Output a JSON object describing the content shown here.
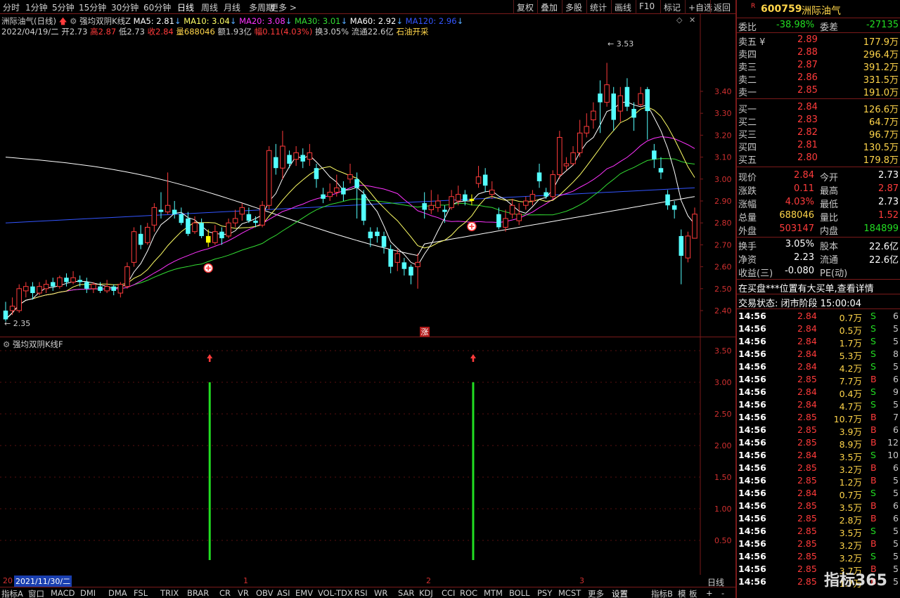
{
  "toolbar": {
    "periods": [
      "分时",
      "1分钟",
      "5分钟",
      "15分钟",
      "30分钟",
      "60分钟",
      "日线",
      "周线",
      "月线",
      "多周期",
      "更多 >"
    ],
    "active_period": "日线",
    "right_buttons": [
      "复权",
      "叠加",
      "多股",
      "统计",
      "画线",
      "F10",
      "标记",
      "+自选",
      "返回"
    ]
  },
  "kline_header": {
    "name": "洲际油气(日线)",
    "indicator": "强均双阴K线Z",
    "ma5": "MA5: 2.81",
    "ma10": "MA10: 3.04",
    "ma20": "MA20: 3.08",
    "ma30": "MA30: 3.01",
    "ma60": "MA60: 2.92",
    "ma120": "MA120: 2.96",
    "date": "2022/04/19/二",
    "open": "开2.73",
    "high": "高2.87",
    "low": "低2.73",
    "close": "收2.84",
    "volume": "量688046",
    "amount": "额1.93亿",
    "change": "幅0.11(4.03%)",
    "turnover": "换3.05%",
    "float": "流通22.6亿",
    "sector": "石油开采"
  },
  "colors": {
    "up": "#ff3b3b",
    "down": "#54ffff",
    "ma5": "#ffffff",
    "ma10": "#ffff66",
    "ma20": "#ff33ff",
    "ma30": "#33dd33",
    "ma60": "#3355ff",
    "ma120": "#ffffff",
    "signal": "#22dd22",
    "highlight": "#ffff00"
  },
  "price_axis": [
    "3.40",
    "3.30",
    "3.20",
    "3.10",
    "3.00",
    "2.90",
    "2.80",
    "2.70",
    "2.60",
    "2.50",
    "2.40"
  ],
  "markers": {
    "high_label": "3.53",
    "low_label": "2.35",
    "zhang": "涨"
  },
  "sub_header": "强均双阴K线F",
  "sub_axis": [
    "3.50",
    "3.00",
    "2.50",
    "2.00",
    "1.50",
    "1.00",
    "0.50"
  ],
  "x_labels": {
    "start_year": "20",
    "cursor_date": "2021/11/30/二",
    "m1": "1",
    "m2": "2",
    "m3": "3",
    "period_tag": "日线"
  },
  "bottom_tabs": [
    "指标A",
    "窗口",
    "MACD",
    "DMI",
    "DMA",
    "FSL",
    "TRIX",
    "BRAR",
    "CR",
    "VR",
    "OBV",
    "ASI",
    "EMV",
    "VOL-TDX",
    "RSI",
    "WR",
    "SAR",
    "KDJ",
    "CCI",
    "ROC",
    "MTM",
    "BOLL",
    "PSY",
    "MCST",
    "更多",
    "设置"
  ],
  "bottom_right_tabs": [
    "指标B",
    "模",
    "板",
    "+",
    "-"
  ],
  "chart_data": {
    "type": "candlestick",
    "title": "",
    "ylim": [
      2.33,
      3.58
    ],
    "candles": [
      [
        2.4,
        2.36,
        2.44,
        2.35
      ],
      [
        2.4,
        2.42,
        2.46,
        2.38
      ],
      [
        2.4,
        2.5,
        2.52,
        2.39
      ],
      [
        2.49,
        2.51,
        2.53,
        2.46
      ],
      [
        2.51,
        2.48,
        2.53,
        2.45
      ],
      [
        2.48,
        2.51,
        2.53,
        2.47
      ],
      [
        2.5,
        2.52,
        2.54,
        2.48
      ],
      [
        2.53,
        2.51,
        2.55,
        2.49
      ],
      [
        2.51,
        2.55,
        2.56,
        2.5
      ],
      [
        2.55,
        2.53,
        2.57,
        2.51
      ],
      [
        2.53,
        2.55,
        2.58,
        2.52
      ],
      [
        2.54,
        2.53,
        2.56,
        2.51
      ],
      [
        2.53,
        2.5,
        2.55,
        2.48
      ],
      [
        2.5,
        2.52,
        2.53,
        2.48
      ],
      [
        2.51,
        2.49,
        2.53,
        2.48
      ],
      [
        2.49,
        2.51,
        2.54,
        2.48
      ],
      [
        2.51,
        2.49,
        2.52,
        2.47
      ],
      [
        2.48,
        2.52,
        2.53,
        2.46
      ],
      [
        2.51,
        2.6,
        2.62,
        2.5
      ],
      [
        2.62,
        2.76,
        2.78,
        2.6
      ],
      [
        2.75,
        2.7,
        2.79,
        2.68
      ],
      [
        2.71,
        2.78,
        2.8,
        2.7
      ],
      [
        2.79,
        2.87,
        2.89,
        2.76
      ],
      [
        2.86,
        2.85,
        2.94,
        2.82
      ],
      [
        2.85,
        2.88,
        3.03,
        2.84
      ],
      [
        2.86,
        2.84,
        2.9,
        2.82
      ],
      [
        2.84,
        2.8,
        2.87,
        2.79
      ],
      [
        2.82,
        2.75,
        2.85,
        2.74
      ],
      [
        2.76,
        2.8,
        2.83,
        2.75
      ],
      [
        2.8,
        2.74,
        2.82,
        2.73
      ],
      [
        2.74,
        2.71,
        2.77,
        2.69
      ],
      [
        2.71,
        2.76,
        2.79,
        2.7
      ],
      [
        2.76,
        2.73,
        2.78,
        2.7
      ],
      [
        2.74,
        2.8,
        2.82,
        2.73
      ],
      [
        2.8,
        2.82,
        2.86,
        2.78
      ],
      [
        2.84,
        2.87,
        2.89,
        2.81
      ],
      [
        2.84,
        2.81,
        2.87,
        2.8
      ],
      [
        2.81,
        2.8,
        2.83,
        2.78
      ],
      [
        2.79,
        2.88,
        2.9,
        2.78
      ],
      [
        2.88,
        3.13,
        3.15,
        2.86
      ],
      [
        3.1,
        3.05,
        3.16,
        3.02
      ],
      [
        3.05,
        3.15,
        3.22,
        3.0
      ],
      [
        3.11,
        3.07,
        3.13,
        3.05
      ],
      [
        3.09,
        3.12,
        3.15,
        3.06
      ],
      [
        3.11,
        3.08,
        3.14,
        3.05
      ],
      [
        3.09,
        3.12,
        3.16,
        3.06
      ],
      [
        3.05,
        3.0,
        3.07,
        2.96
      ],
      [
        2.93,
        2.91,
        2.96,
        2.89
      ],
      [
        2.92,
        2.94,
        2.98,
        2.9
      ],
      [
        2.94,
        2.96,
        3.02,
        2.92
      ],
      [
        2.96,
        2.93,
        2.99,
        2.9
      ],
      [
        3.0,
        3.02,
        3.07,
        2.98
      ],
      [
        3.0,
        2.96,
        3.03,
        2.82
      ],
      [
        2.93,
        2.81,
        2.95,
        2.79
      ],
      [
        2.76,
        2.73,
        2.78,
        2.69
      ],
      [
        2.76,
        2.74,
        2.78,
        2.71
      ],
      [
        2.74,
        2.69,
        2.76,
        2.66
      ],
      [
        2.68,
        2.6,
        2.7,
        2.57
      ],
      [
        2.62,
        2.66,
        2.68,
        2.58
      ],
      [
        2.62,
        2.59,
        2.64,
        2.56
      ],
      [
        2.6,
        2.56,
        2.61,
        2.52
      ],
      [
        2.6,
        2.62,
        2.66,
        2.5
      ],
      [
        2.89,
        2.86,
        2.94,
        2.82
      ],
      [
        2.86,
        2.88,
        2.95,
        2.84
      ],
      [
        2.87,
        2.9,
        2.93,
        2.85
      ],
      [
        2.86,
        2.85,
        2.88,
        2.8
      ],
      [
        2.87,
        2.92,
        2.95,
        2.86
      ],
      [
        2.9,
        2.93,
        2.97,
        2.88
      ],
      [
        2.93,
        2.9,
        2.95,
        2.88
      ],
      [
        2.91,
        2.9,
        2.93,
        2.88
      ],
      [
        2.98,
        3.01,
        3.06,
        2.96
      ],
      [
        3.02,
        2.97,
        3.05,
        2.94
      ],
      [
        2.93,
        2.95,
        2.99,
        2.91
      ],
      [
        2.84,
        2.78,
        2.87,
        2.77
      ],
      [
        2.78,
        2.82,
        2.86,
        2.76
      ],
      [
        2.84,
        2.88,
        2.91,
        2.82
      ],
      [
        2.81,
        2.84,
        2.89,
        2.79
      ],
      [
        2.88,
        2.9,
        2.92,
        2.86
      ],
      [
        2.9,
        2.93,
        2.95,
        2.88
      ],
      [
        3.03,
        2.99,
        3.07,
        2.96
      ],
      [
        2.94,
        2.92,
        2.96,
        2.91
      ],
      [
        2.92,
        3.02,
        3.04,
        2.91
      ],
      [
        3.02,
        3.19,
        3.22,
        3.0
      ],
      [
        3.06,
        3.07,
        3.1,
        3.04
      ],
      [
        3.07,
        3.12,
        3.15,
        3.06
      ],
      [
        3.12,
        3.21,
        3.27,
        3.1
      ],
      [
        3.21,
        3.24,
        3.3,
        3.19
      ],
      [
        3.27,
        3.31,
        3.35,
        3.23
      ],
      [
        3.39,
        3.35,
        3.45,
        3.21
      ],
      [
        3.35,
        3.43,
        3.53,
        3.33
      ],
      [
        3.39,
        3.27,
        3.42,
        3.22
      ],
      [
        3.31,
        3.38,
        3.42,
        3.26
      ],
      [
        3.42,
        3.33,
        3.46,
        3.31
      ],
      [
        3.32,
        3.28,
        3.35,
        3.22
      ],
      [
        3.34,
        3.39,
        3.42,
        3.33
      ],
      [
        3.41,
        3.31,
        3.42,
        3.18
      ],
      [
        3.13,
        3.09,
        3.16,
        3.05
      ],
      [
        3.05,
        3.03,
        3.1,
        3.0
      ],
      [
        2.93,
        2.88,
        2.95,
        2.86
      ],
      [
        2.88,
        2.86,
        2.9,
        2.82
      ],
      [
        2.74,
        2.65,
        2.77,
        2.52
      ],
      [
        2.64,
        2.74,
        2.76,
        2.62
      ],
      [
        2.73,
        2.84,
        2.87,
        2.73
      ]
    ],
    "highlight_indices": [
      30,
      69
    ],
    "signal_indices": [
      30,
      69
    ],
    "signal_value": 3.0,
    "sub_ylim": [
      0,
      3.7
    ]
  },
  "panel": {
    "stock_code": "600759",
    "stock_name": "洲际油气",
    "webi_label": "委比",
    "webi_value": "-38.98%",
    "weicha_label": "委差",
    "weicha_value": "-27135",
    "sells": [
      {
        "label": "卖五",
        "price": "2.89",
        "vol": "177.9万"
      },
      {
        "label": "卖四",
        "price": "2.88",
        "vol": "296.4万"
      },
      {
        "label": "卖三",
        "price": "2.87",
        "vol": "391.2万"
      },
      {
        "label": "卖二",
        "price": "2.86",
        "vol": "331.5万"
      },
      {
        "label": "卖一",
        "price": "2.85",
        "vol": "191.0万"
      }
    ],
    "buys": [
      {
        "label": "买一",
        "price": "2.84",
        "vol": "126.6万"
      },
      {
        "label": "买二",
        "price": "2.83",
        "vol": "64.7万"
      },
      {
        "label": "买三",
        "price": "2.82",
        "vol": "96.7万"
      },
      {
        "label": "买四",
        "price": "2.81",
        "vol": "130.5万"
      },
      {
        "label": "买五",
        "price": "2.80",
        "vol": "179.8万"
      }
    ],
    "stats": [
      {
        "l1": "现价",
        "v1": "2.84",
        "l2": "今开",
        "v2": "2.73",
        "c1": "red",
        "c2": "white"
      },
      {
        "l1": "涨跌",
        "v1": "0.11",
        "l2": "最高",
        "v2": "2.87",
        "c1": "red",
        "c2": "red"
      },
      {
        "l1": "涨幅",
        "v1": "4.03%",
        "l2": "最低",
        "v2": "2.73",
        "c1": "red",
        "c2": "white"
      },
      {
        "l1": "总量",
        "v1": "688046",
        "l2": "量比",
        "v2": "1.52",
        "c1": "yellow",
        "c2": "red"
      },
      {
        "l1": "外盘",
        "v1": "503147",
        "l2": "内盘",
        "v2": "184899",
        "c1": "red",
        "c2": "green"
      }
    ],
    "stats2": [
      {
        "l1": "换手",
        "v1": "3.05%",
        "l2": "股本",
        "v2": "22.6亿"
      },
      {
        "l1": "净资",
        "v1": "2.23",
        "l2": "流通",
        "v2": "22.6亿"
      },
      {
        "l1": "收益(三)",
        "v1": "-0.080",
        "l2": "PE(动)",
        "v2": ""
      }
    ],
    "notice": "在买盘***位置有大买单,查看详情",
    "trade_status": "交易状态: 闭市阶段 15:00:04",
    "ticks": [
      {
        "t": "14:56",
        "p": "2.84",
        "v": "0.7万",
        "s": "S",
        "n": "6"
      },
      {
        "t": "14:56",
        "p": "2.84",
        "v": "0.5万",
        "s": "S",
        "n": "5"
      },
      {
        "t": "14:56",
        "p": "2.84",
        "v": "1.7万",
        "s": "S",
        "n": "5"
      },
      {
        "t": "14:56",
        "p": "2.84",
        "v": "5.3万",
        "s": "S",
        "n": "8"
      },
      {
        "t": "14:56",
        "p": "2.84",
        "v": "4.2万",
        "s": "S",
        "n": "5"
      },
      {
        "t": "14:56",
        "p": "2.85",
        "v": "7.7万",
        "s": "B",
        "n": "6"
      },
      {
        "t": "14:56",
        "p": "2.84",
        "v": "0.4万",
        "s": "S",
        "n": "9"
      },
      {
        "t": "14:56",
        "p": "2.84",
        "v": "4.7万",
        "s": "S",
        "n": "5"
      },
      {
        "t": "14:56",
        "p": "2.85",
        "v": "10.7万",
        "s": "B",
        "n": "7"
      },
      {
        "t": "14:56",
        "p": "2.85",
        "v": "3.9万",
        "s": "B",
        "n": "6"
      },
      {
        "t": "14:56",
        "p": "2.85",
        "v": "8.9万",
        "s": "B",
        "n": "12"
      },
      {
        "t": "14:56",
        "p": "2.84",
        "v": "3.5万",
        "s": "S",
        "n": "10"
      },
      {
        "t": "14:56",
        "p": "2.85",
        "v": "3.2万",
        "s": "B",
        "n": "6"
      },
      {
        "t": "14:56",
        "p": "2.85",
        "v": "1.2万",
        "s": "B",
        "n": "5"
      },
      {
        "t": "14:56",
        "p": "2.84",
        "v": "0.7万",
        "s": "S",
        "n": "5"
      },
      {
        "t": "14:56",
        "p": "2.85",
        "v": "3.5万",
        "s": "B",
        "n": "6"
      },
      {
        "t": "14:56",
        "p": "2.85",
        "v": "2.8万",
        "s": "B",
        "n": "6"
      },
      {
        "t": "14:56",
        "p": "2.85",
        "v": "3.5万",
        "s": "S",
        "n": "5"
      },
      {
        "t": "14:56",
        "p": "2.85",
        "v": "3.2万",
        "s": "B",
        "n": "5"
      },
      {
        "t": "14:56",
        "p": "2.85",
        "v": "3.2万",
        "s": "S",
        "n": "5"
      },
      {
        "t": "14:56",
        "p": "2.85",
        "v": "3.7万",
        "s": "B",
        "n": "5"
      },
      {
        "t": "14:56",
        "p": "2.85",
        "v": "1.7万",
        "s": "B",
        "n": "5"
      }
    ],
    "watermark": "指标365"
  }
}
